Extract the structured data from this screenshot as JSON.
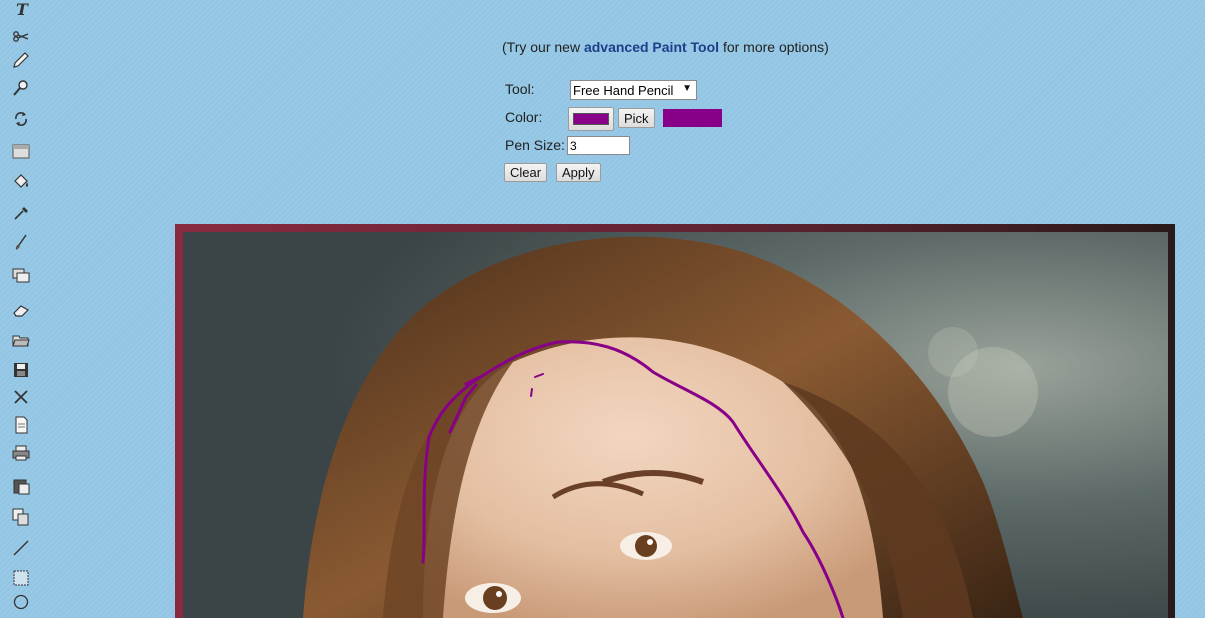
{
  "toolbar": {
    "tools": [
      {
        "name": "text-icon",
        "glyph": "T"
      },
      {
        "name": "scissors-icon",
        "glyph": "✂"
      },
      {
        "name": "pencil-icon",
        "glyph": "✎"
      },
      {
        "name": "zoom-icon",
        "glyph": "⚲"
      },
      {
        "name": "rotate-icon",
        "glyph": "⟳"
      },
      {
        "name": "gradient-icon",
        "glyph": "▤"
      },
      {
        "name": "fill-bucket-icon",
        "glyph": "◈"
      },
      {
        "name": "eyedropper-icon",
        "glyph": "⁄"
      },
      {
        "name": "brush-icon",
        "glyph": "∕"
      },
      {
        "name": "layers-icon",
        "glyph": "❐"
      },
      {
        "name": "eraser-icon",
        "glyph": "▱"
      },
      {
        "name": "open-folder-icon",
        "glyph": "▭"
      },
      {
        "name": "save-icon",
        "glyph": "▪"
      },
      {
        "name": "close-icon",
        "glyph": "✕"
      },
      {
        "name": "new-document-icon",
        "glyph": "▯"
      },
      {
        "name": "print-icon",
        "glyph": "⎙"
      },
      {
        "name": "paste-icon",
        "glyph": "▣"
      },
      {
        "name": "copy-icon",
        "glyph": "⧉"
      },
      {
        "name": "line-icon",
        "glyph": "╱"
      },
      {
        "name": "rectangle-select-icon",
        "glyph": "▦"
      },
      {
        "name": "circle-icon",
        "glyph": "○"
      }
    ]
  },
  "promo": {
    "prefix": "(Try our new ",
    "link": "advanced Paint Tool",
    "suffix": " for more options)"
  },
  "controls": {
    "tool_label": "Tool:",
    "tool_value": "Free Hand Pencil",
    "tool_options": [
      "Free Hand Pencil"
    ],
    "color_label": "Color:",
    "color_value": "#880088",
    "pick_label": "Pick",
    "pen_size_label": "Pen Size:",
    "pen_size_value": "3",
    "clear_label": "Clear",
    "apply_label": "Apply"
  },
  "colors": {
    "background": "#93c6e4",
    "link": "#1d3f8a",
    "stroke": "#880088",
    "frame": "#8a2a40"
  }
}
